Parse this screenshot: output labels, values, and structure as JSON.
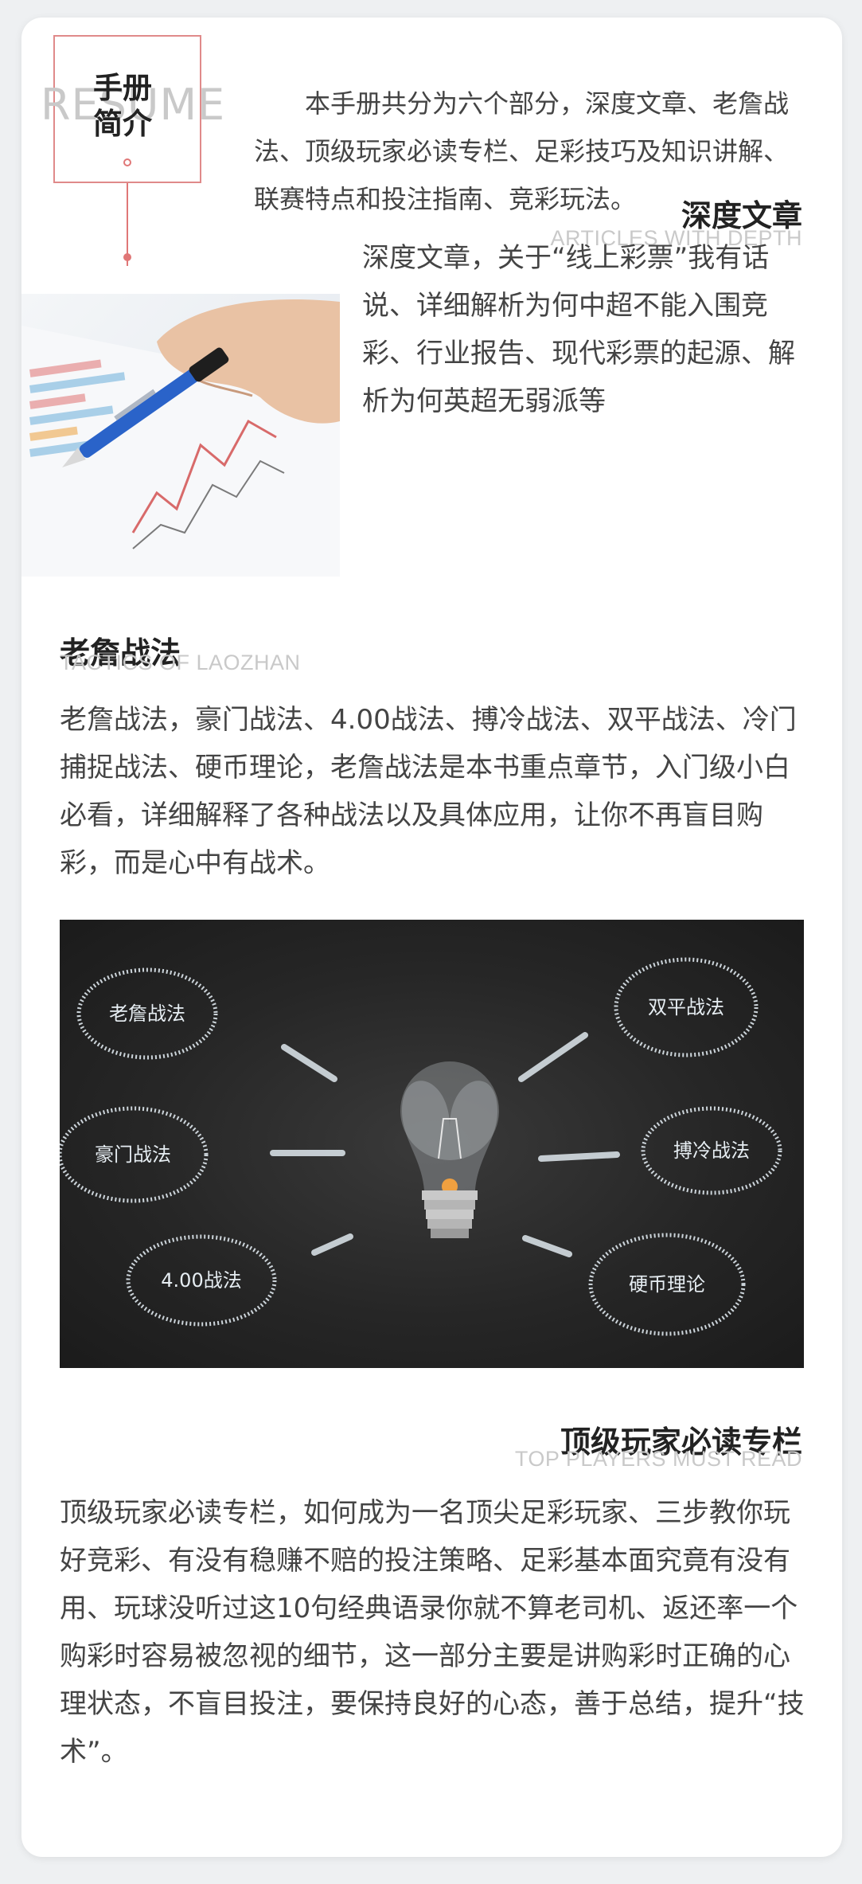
{
  "intro": {
    "watermark": "RESUME",
    "title_line1": "手册",
    "title_line2": "简介",
    "text": "本手册共分为六个部分，深度文章、老詹战法、顶级玩家必读专栏、足彩技巧及知识讲解、联赛特点和投注指南、竞彩玩法。"
  },
  "articles": {
    "title": "深度文章",
    "subtitle": "ARTICLES WITH DEPTH",
    "text": "深度文章，关于“线上彩票”我有话说、详细解析为何中超不能入围竞彩、行业报告、现代彩票的起源、解析为何英超无弱派等"
  },
  "laozhan": {
    "title": "老詹战法",
    "subtitle": "TACTICS OF LAOZHAN",
    "text": "老詹战法，豪门战法、4.00战法、搏冷战法、双平战法、冷门捕捉战法、硬币理论，老詹战法是本书重点章节，入门级小白必看，详细解释了各种战法以及具体应用，让你不再盲目购彩，而是心中有战术。"
  },
  "chalkboard": {
    "labels": [
      "老詹战法",
      "豪门战法",
      "4.00战法",
      "双平战法",
      "搏冷战法",
      "硬币理论"
    ]
  },
  "top_players": {
    "title": "顶级玩家必读专栏",
    "subtitle": "TOP PLAYERS MUST READ",
    "text": "顶级玩家必读专栏，如何成为一名顶尖足彩玩家、三步教你玩好竞彩、有没有稳赚不赔的投注策略、足彩基本面究竟有没有用、玩球没听过这10句经典语录你就不算老司机、返还率一个购彩时容易被忽视的细节，这一部分主要是讲购彩时正确的心理状态，不盲目投注，要保持良好的心态，善于总结，提升“技术”。"
  },
  "colors": {
    "accent": "#e07777",
    "text": "#444444",
    "watermark": "#c9c9c9",
    "chalk": "#dfe8ee"
  }
}
